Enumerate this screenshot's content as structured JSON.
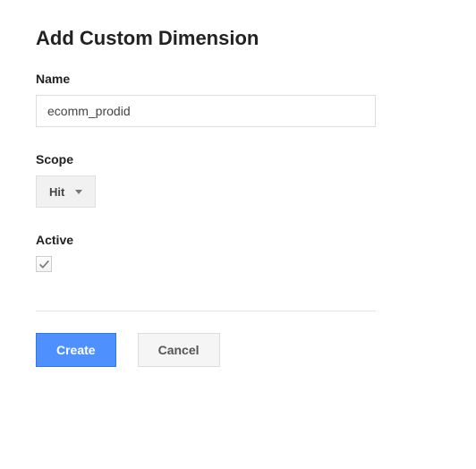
{
  "page": {
    "title": "Add Custom Dimension"
  },
  "fields": {
    "name": {
      "label": "Name",
      "value": "ecomm_prodid"
    },
    "scope": {
      "label": "Scope",
      "selected": "Hit"
    },
    "active": {
      "label": "Active",
      "checked": true
    }
  },
  "buttons": {
    "create": "Create",
    "cancel": "Cancel"
  }
}
